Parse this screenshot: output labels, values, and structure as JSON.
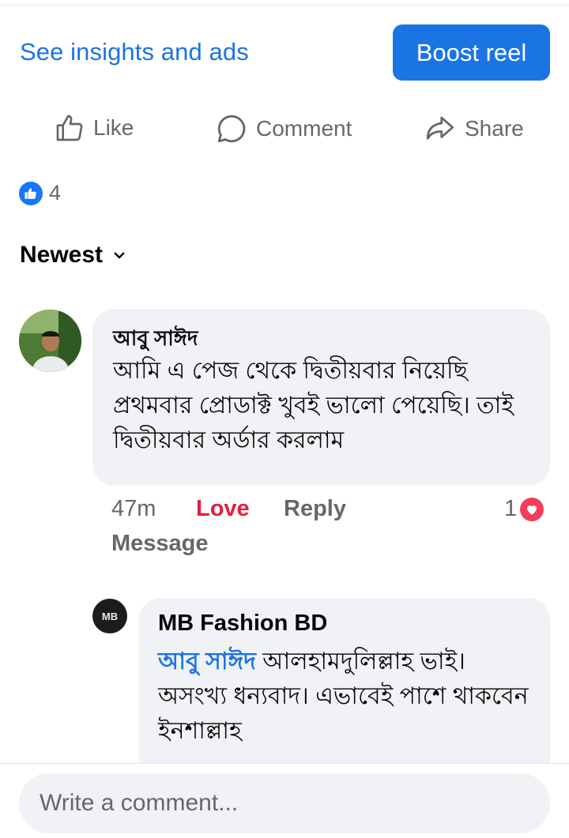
{
  "header": {
    "insights_link": "See insights and ads",
    "boost_button": "Boost reel"
  },
  "actions": {
    "like": "Like",
    "comment": "Comment",
    "share": "Share"
  },
  "reactions": {
    "count": "4",
    "icon": "like-reaction-icon",
    "color": "#1877f2"
  },
  "sort": {
    "label": "Newest",
    "icon": "chevron-down-icon"
  },
  "comments": [
    {
      "author": "আবু সাঈদ",
      "text": "আমি এ পেজ থেকে দ্বিতীয়বার নিয়েছি প্রথমবার প্রোডাক্ট খুবই ভালো পেয়েছি। তাই দ্বিতীয়বার অর্ডার করলাম",
      "time": "47m",
      "reaction_label": "Love",
      "reply_label": "Reply",
      "message_label": "Message",
      "reaction_count": "1"
    }
  ],
  "reply": {
    "author": "MB Fashion BD",
    "avatar_text": "MB",
    "mention": "আবু সাঈদ",
    "text": " আলহামদুলিল্লাহ ভাই। অসংখ্য ধন্যবাদ। এভাবেই পাশে থাকবেন ইনশাল্লাহ"
  },
  "composer": {
    "placeholder": "Write a comment..."
  },
  "colors": {
    "accent": "#1b74e4",
    "love": "#e41e3f",
    "bubble": "#f0f2f5",
    "muted_text": "#65676b"
  }
}
